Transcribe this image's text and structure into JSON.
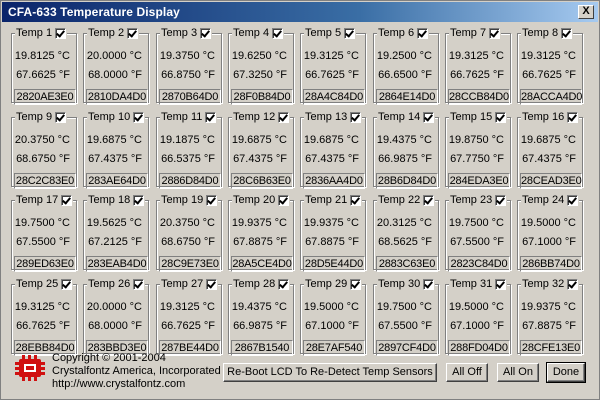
{
  "window": {
    "title": "CFA-633 Temperature Display",
    "close_label": "X"
  },
  "sensors": [
    {
      "label": "Temp 1",
      "c": "19.8125 °C",
      "f": "67.6625 °F",
      "rom": "2820AE3E0"
    },
    {
      "label": "Temp 2",
      "c": "20.0000 °C",
      "f": "68.0000 °F",
      "rom": "2810DA4D0"
    },
    {
      "label": "Temp 3",
      "c": "19.3750 °C",
      "f": "66.8750 °F",
      "rom": "2870B64D0"
    },
    {
      "label": "Temp 4",
      "c": "19.6250 °C",
      "f": "67.3250 °F",
      "rom": "28F0B84D0"
    },
    {
      "label": "Temp 5",
      "c": "19.3125 °C",
      "f": "66.7625 °F",
      "rom": "28A4C84D0"
    },
    {
      "label": "Temp 6",
      "c": "19.2500 °C",
      "f": "66.6500 °F",
      "rom": "2864E14D0"
    },
    {
      "label": "Temp 7",
      "c": "19.3125 °C",
      "f": "66.7625 °F",
      "rom": "28CCB84D0"
    },
    {
      "label": "Temp 8",
      "c": "19.3125 °C",
      "f": "66.7625 °F",
      "rom": "28ACCA4D0"
    },
    {
      "label": "Temp 9",
      "c": "20.3750 °C",
      "f": "68.6750 °F",
      "rom": "28C2C83E0"
    },
    {
      "label": "Temp 10",
      "c": "19.6875 °C",
      "f": "67.4375 °F",
      "rom": "283AE64D0"
    },
    {
      "label": "Temp 11",
      "c": "19.1875 °C",
      "f": "66.5375 °F",
      "rom": "2886D84D0"
    },
    {
      "label": "Temp 12",
      "c": "19.6875 °C",
      "f": "67.4375 °F",
      "rom": "28C6B63E0"
    },
    {
      "label": "Temp 13",
      "c": "19.6875 °C",
      "f": "67.4375 °F",
      "rom": "2836AA4D0"
    },
    {
      "label": "Temp 14",
      "c": "19.4375 °C",
      "f": "66.9875 °F",
      "rom": "28B6D84D0"
    },
    {
      "label": "Temp 15",
      "c": "19.8750 °C",
      "f": "67.7750 °F",
      "rom": "284EDA3E0"
    },
    {
      "label": "Temp 16",
      "c": "19.6875 °C",
      "f": "67.4375 °F",
      "rom": "28CEAD3E0"
    },
    {
      "label": "Temp 17",
      "c": "19.7500 °C",
      "f": "67.5500 °F",
      "rom": "289ED63E0"
    },
    {
      "label": "Temp 18",
      "c": "19.5625 °C",
      "f": "67.2125 °F",
      "rom": "283EAB4D0"
    },
    {
      "label": "Temp 19",
      "c": "20.3750 °C",
      "f": "68.6750 °F",
      "rom": "28C9E73E0"
    },
    {
      "label": "Temp 20",
      "c": "19.9375 °C",
      "f": "67.8875 °F",
      "rom": "28A5CE4D0"
    },
    {
      "label": "Temp 21",
      "c": "19.9375 °C",
      "f": "67.8875 °F",
      "rom": "28D5E44D0"
    },
    {
      "label": "Temp 22",
      "c": "20.3125 °C",
      "f": "68.5625 °F",
      "rom": "2883C63E0"
    },
    {
      "label": "Temp 23",
      "c": "19.7500 °C",
      "f": "67.5500 °F",
      "rom": "2823C84D0"
    },
    {
      "label": "Temp 24",
      "c": "19.5000 °C",
      "f": "67.1000 °F",
      "rom": "286BB74D0"
    },
    {
      "label": "Temp 25",
      "c": "19.3125 °C",
      "f": "66.7625 °F",
      "rom": "28EBB84D0"
    },
    {
      "label": "Temp 26",
      "c": "20.0000 °C",
      "f": "68.0000 °F",
      "rom": "283BBD3E0"
    },
    {
      "label": "Temp 27",
      "c": "19.3125 °C",
      "f": "66.7625 °F",
      "rom": "287BE44D0"
    },
    {
      "label": "Temp 28",
      "c": "19.4375 °C",
      "f": "66.9875 °F",
      "rom": "2867B1540"
    },
    {
      "label": "Temp 29",
      "c": "19.5000 °C",
      "f": "67.1000 °F",
      "rom": "28E7AF540"
    },
    {
      "label": "Temp 30",
      "c": "19.7500 °C",
      "f": "67.5500 °F",
      "rom": "2897CF4D0"
    },
    {
      "label": "Temp 31",
      "c": "19.5000 °C",
      "f": "67.1000 °F",
      "rom": "288FD04D0"
    },
    {
      "label": "Temp 32",
      "c": "19.9375 °C",
      "f": "67.8875 °F",
      "rom": "28CFE13E0"
    }
  ],
  "footer": {
    "copyright": "Copyright © 2001-2004",
    "company": "Crystalfontz America, Incorporated",
    "url": "http://www.crystalfontz.com",
    "reboot_label": "Re-Boot LCD To Re-Detect Temp Sensors",
    "all_off_label": "All Off",
    "all_on_label": "All On",
    "done_label": "Done"
  },
  "colors": {
    "logo_red": "#d01010",
    "title_blue": "#0a246a"
  }
}
